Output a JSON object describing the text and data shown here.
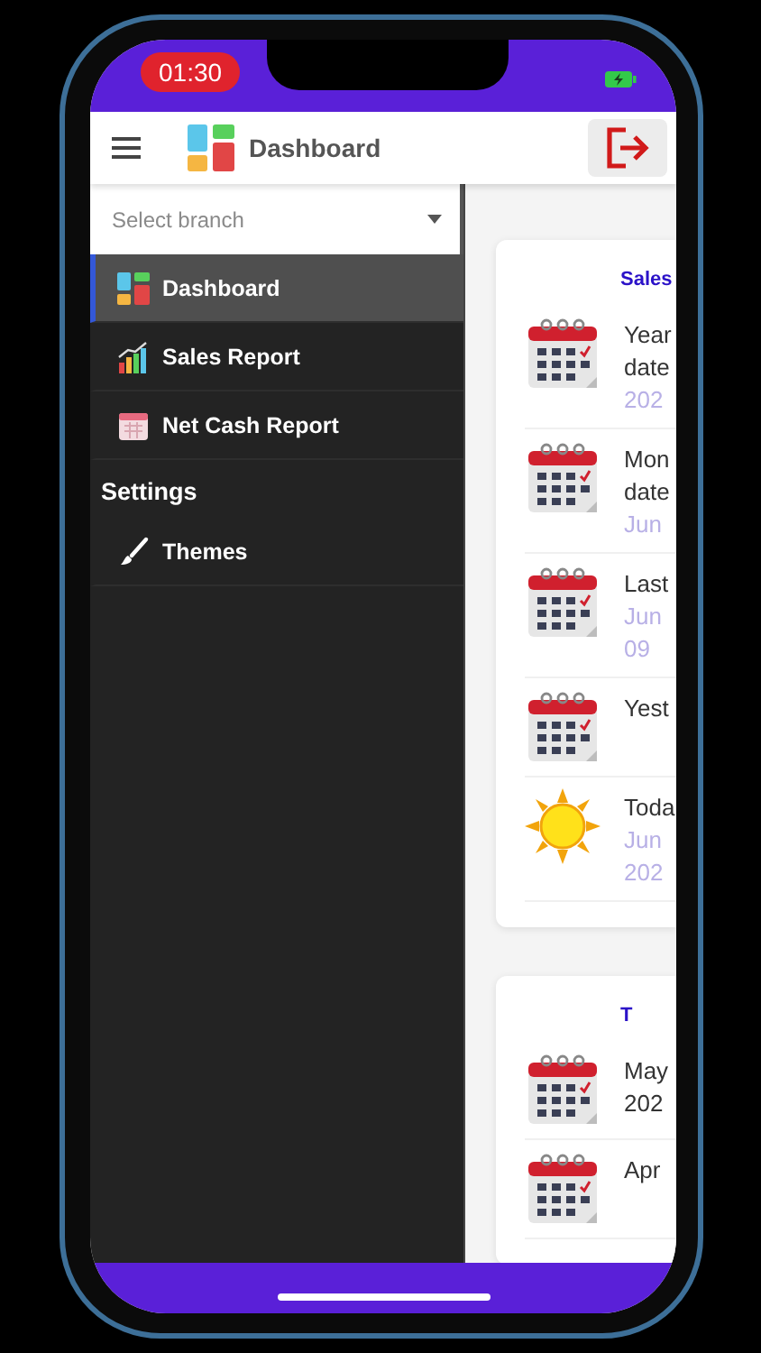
{
  "status_bar": {
    "time": "01:30"
  },
  "header": {
    "title": "Dashboard"
  },
  "drawer": {
    "branch_select": {
      "placeholder": "Select branch"
    },
    "items": [
      {
        "label": "Dashboard",
        "kind": "tiles",
        "selected": true
      },
      {
        "label": "Sales Report",
        "kind": "chart",
        "selected": false
      },
      {
        "label": "Net Cash Report",
        "kind": "calendar",
        "selected": false
      }
    ],
    "section": "Settings",
    "settings_items": [
      {
        "label": "Themes",
        "kind": "brush",
        "selected": false
      }
    ]
  },
  "cards": [
    {
      "title": "Sales",
      "rows": [
        {
          "kind": "calendar",
          "lines": [
            "Year",
            "date"
          ],
          "sub_lines": [
            "202"
          ]
        },
        {
          "kind": "calendar",
          "lines": [
            "Mon",
            "date"
          ],
          "sub_lines": [
            "Jun"
          ]
        },
        {
          "kind": "calendar",
          "lines": [
            "Last"
          ],
          "sub_lines": [
            "Jun",
            "09"
          ]
        },
        {
          "kind": "calendar",
          "lines": [
            "Yest"
          ]
        },
        {
          "kind": "sun",
          "lines": [
            "Toda"
          ],
          "sub_lines": [
            "Jun",
            "202"
          ]
        }
      ]
    },
    {
      "title": "T",
      "rows": [
        {
          "kind": "calendar",
          "lines": [
            "May",
            "202"
          ]
        },
        {
          "kind": "calendar",
          "lines": [
            "Apr"
          ]
        }
      ]
    }
  ]
}
